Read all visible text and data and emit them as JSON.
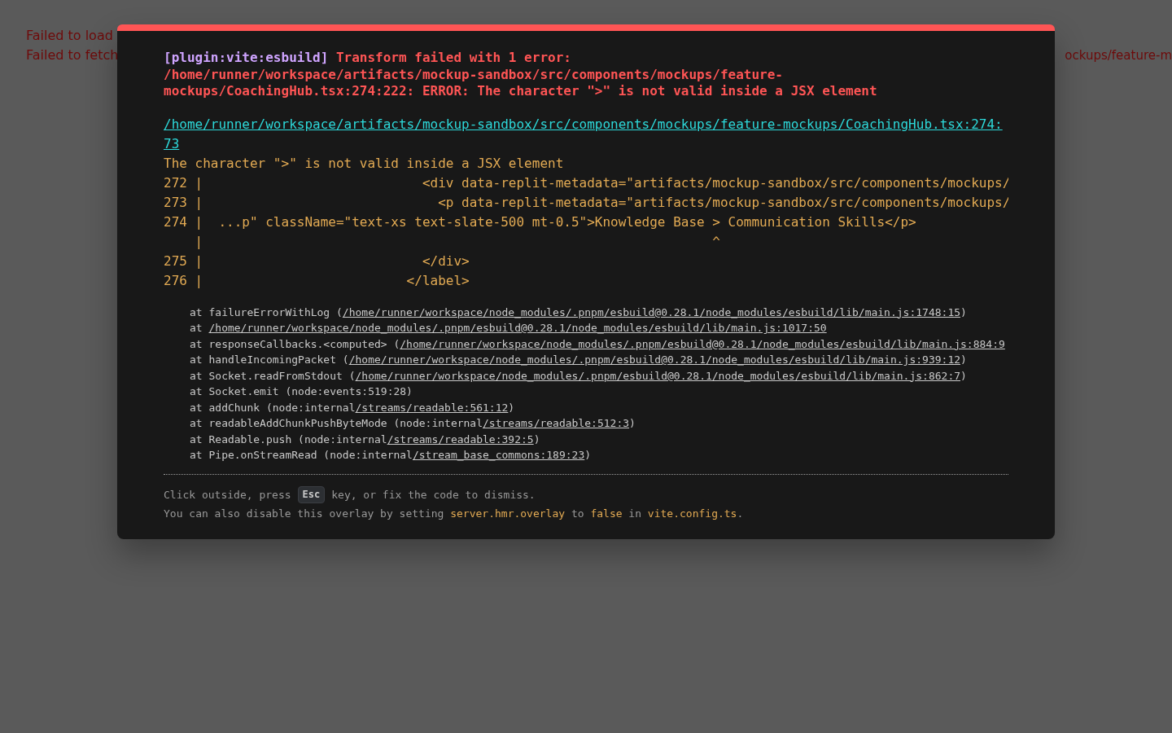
{
  "page": {
    "messages": [
      {
        "text": "Failed to load"
      },
      {
        "text": "Failed to fetch"
      }
    ],
    "right_fragment": "ockups/feature-m"
  },
  "overlay": {
    "plugin": "[plugin:vite:esbuild]",
    "message": "Transform failed with 1 error:\n/home/runner/workspace/artifacts/mockup-sandbox/src/components/mockups/feature-mockups/CoachingHub.tsx:274:222: ERROR: The character \">\" is not valid inside a JSX element",
    "file": "/home/runner/workspace/artifacts/mockup-sandbox/src/components/mockups/feature-mockups/CoachingHub.tsx:274:73",
    "frame": [
      "The character \">\" is not valid inside a JSX element",
      "272 |                            <div data-replit-metadata=\"artifacts/mockup-sandbox/src/components/mockups/",
      "273 |                              <p data-replit-metadata=\"artifacts/mockup-sandbox/src/components/mockups/",
      "274 |  ...p\" className=\"text-xs text-slate-500 mt-0.5\">Knowledge Base > Communication Skills</p>",
      "    |                                                                 ^",
      "275 |                            </div>",
      "276 |                          </label>"
    ],
    "stack": [
      {
        "prefix": "at failureErrorWithLog (",
        "link": "/home/runner/workspace/node_modules/.pnpm/esbuild@0.28.1/node_modules/esbuild/lib/main.js:1748:15",
        "suffix": ")"
      },
      {
        "prefix": "at ",
        "link": "/home/runner/workspace/node_modules/.pnpm/esbuild@0.28.1/node_modules/esbuild/lib/main.js:1017:50"
      },
      {
        "prefix": "at responseCallbacks.<computed> (",
        "link": "/home/runner/workspace/node_modules/.pnpm/esbuild@0.28.1/node_modules/esbuild/lib/main.js:884:9"
      },
      {
        "prefix": "at handleIncomingPacket (",
        "link": "/home/runner/workspace/node_modules/.pnpm/esbuild@0.28.1/node_modules/esbuild/lib/main.js:939:12",
        "suffix": ")"
      },
      {
        "prefix": "at Socket.readFromStdout (",
        "link": "/home/runner/workspace/node_modules/.pnpm/esbuild@0.28.1/node_modules/esbuild/lib/main.js:862:7",
        "suffix": ")"
      },
      {
        "prefix": "at Socket.emit (node:events:519:28)"
      },
      {
        "prefix": "at addChunk (node:internal",
        "link": "/streams/readable:561:12",
        "suffix": ")"
      },
      {
        "prefix": "at readableAddChunkPushByteMode (node:internal",
        "link": "/streams/readable:512:3",
        "suffix": ")"
      },
      {
        "prefix": "at Readable.push (node:internal",
        "link": "/streams/readable:392:5",
        "suffix": ")"
      },
      {
        "prefix": "at Pipe.onStreamRead (node:internal",
        "link": "/stream_base_commons:189:23",
        "suffix": ")"
      }
    ],
    "tip": {
      "before": "Click outside, press",
      "key": "Esc",
      "after": "key, or fix the code to dismiss."
    },
    "tip2": [
      {
        "text": "You can also disable this overlay by setting ",
        "code": false
      },
      {
        "text": "server.hmr.overlay",
        "code": true
      },
      {
        "text": " to ",
        "code": false
      },
      {
        "text": "false",
        "code": true
      },
      {
        "text": " in ",
        "code": false
      },
      {
        "text": "vite.config.ts",
        "code": true
      },
      {
        "text": ".",
        "code": false
      }
    ]
  }
}
